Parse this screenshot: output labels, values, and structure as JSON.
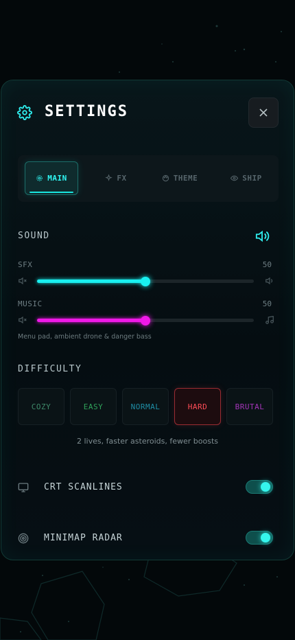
{
  "header": {
    "title": "SETTINGS"
  },
  "tabs": [
    {
      "label": "MAIN",
      "icon": "gear-icon",
      "active": true
    },
    {
      "label": "FX",
      "icon": "sparkle-icon",
      "active": false
    },
    {
      "label": "THEME",
      "icon": "palette-icon",
      "active": false
    },
    {
      "label": "SHIP",
      "icon": "eye-icon",
      "active": false
    }
  ],
  "sound": {
    "title": "SOUND",
    "sfx": {
      "label": "SFX",
      "value": "50",
      "level": 0.5,
      "color": "#19f0f0"
    },
    "music": {
      "label": "MUSIC",
      "value": "50",
      "level": 0.5,
      "color": "#f019e8"
    },
    "hint": "Menu pad, ambient drone & danger bass"
  },
  "difficulty": {
    "title": "DIFFICULTY",
    "options": [
      {
        "label": "COZY",
        "color": "#3f8a6a"
      },
      {
        "label": "EASY",
        "color": "#2fa15a"
      },
      {
        "label": "NORMAL",
        "color": "#1f8ea6"
      },
      {
        "label": "HARD",
        "color": "#ff4d57"
      },
      {
        "label": "BRUTAL",
        "color": "#a335b8"
      }
    ],
    "selected": "HARD",
    "description": "2 lives, faster asteroids, fewer boosts"
  },
  "toggles": [
    {
      "label": "CRT SCANLINES",
      "icon": "monitor-icon",
      "on": true
    },
    {
      "label": "MINIMAP RADAR",
      "icon": "radar-icon",
      "on": true
    }
  ],
  "colors": {
    "accent": "#19f0f0",
    "magenta": "#f019e8",
    "danger": "#ff4d57"
  }
}
